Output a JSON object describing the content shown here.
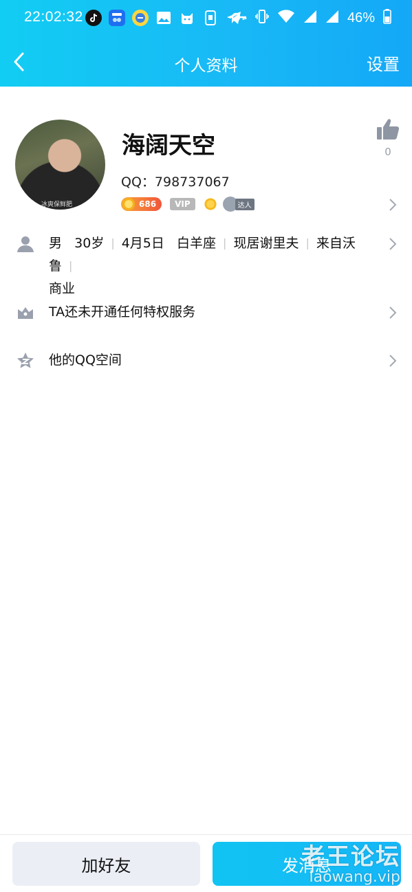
{
  "status_bar": {
    "time": "22:02:32",
    "battery_percent": "46%",
    "app_icons": [
      "tiktok-icon",
      "weather-app-icon",
      "sticker-app-icon",
      "gallery-icon",
      "cat-app-icon",
      "phone-manager-icon",
      "telegram-icon"
    ],
    "system_icons": [
      "vpn-key-icon",
      "vibrate-icon",
      "wifi-icon",
      "signal-icon",
      "signal-icon",
      "battery-icon"
    ]
  },
  "nav": {
    "back_icon": "chevron-left-icon",
    "title": "个人资料",
    "settings_label": "设置"
  },
  "profile": {
    "nickname": "海阔天空",
    "qq_label": "QQ：798737067",
    "level_badge": "686",
    "vip_badge": "VIP",
    "talent_badge": "达人",
    "avatar_caption": "冰爽保鲜肥",
    "like_count": "0"
  },
  "rows": {
    "basic_info": {
      "gender": "男",
      "age": "30岁",
      "birthday": "4月5日",
      "zodiac": "白羊座",
      "location": "现居谢里夫",
      "hometown": "来自沃鲁",
      "separator": "|",
      "occupation": "商业"
    },
    "privilege": {
      "label": "TA还未开通任何特权服务"
    },
    "qzone": {
      "label": "他的QQ空间"
    }
  },
  "bottom": {
    "add_friend_label": "加好友",
    "send_message_label": "发消息"
  },
  "watermark": {
    "text_cn": "老王论坛",
    "text_en": "laowang.vip"
  },
  "colors": {
    "header_gradient_start": "#12cdf3",
    "header_gradient_end": "#14a8f7",
    "icon_gray": "#9aa0ad",
    "add_button_bg": "#ebeff5"
  }
}
